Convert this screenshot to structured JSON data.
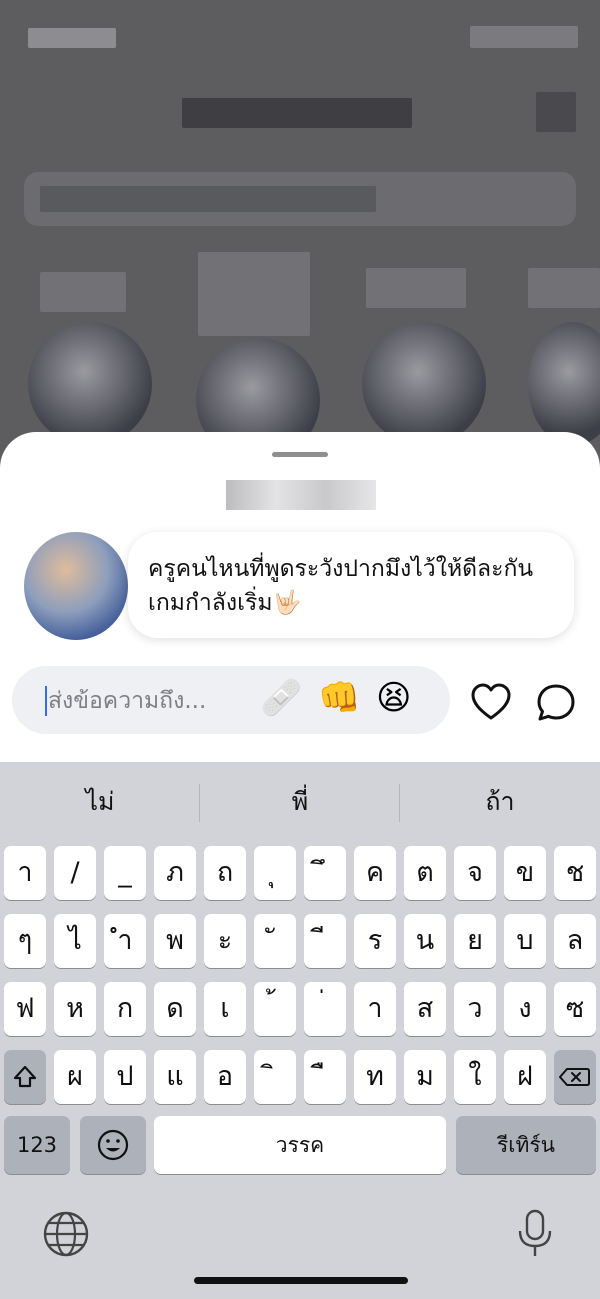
{
  "message": {
    "text": "ครูคนไหนที่พูดระวังปากมึงไว้ให้ดีละกัน เกมกำลังเริ่ม🤟🏻"
  },
  "composer": {
    "placeholder": "ส่งข้อความถึง...",
    "quick_reactions": [
      "🩹",
      "👊",
      "😫"
    ]
  },
  "keyboard": {
    "suggestions": [
      "ไม่",
      "พี่",
      "ถ้า"
    ],
    "rows": [
      [
        "า",
        "/",
        "_",
        "ภ",
        "ถ",
        "ุ",
        "ึ",
        "ค",
        "ต",
        "จ",
        "ข",
        "ช"
      ],
      [
        "ๆ",
        "ไ",
        "ำ",
        "พ",
        "ะ",
        "ั",
        "ี",
        "ร",
        "น",
        "ย",
        "บ",
        "ล"
      ],
      [
        "ฟ",
        "ห",
        "ก",
        "ด",
        "เ",
        "้",
        "่",
        "า",
        "ส",
        "ว",
        "ง",
        "ซ"
      ],
      [
        "ผ",
        "ป",
        "แ",
        "อ",
        "ิ",
        "ื",
        "ท",
        "ม",
        "ใ",
        "ฝ"
      ]
    ],
    "numbers_label": "123",
    "space_label": "วรรค",
    "return_label": "รีเทิร์น",
    "shift_icon": "shift-arrow-icon",
    "delete_icon": "backspace-icon",
    "emoji_icon": "emoji-icon",
    "globe_icon": "globe-icon",
    "mic_icon": "microphone-icon"
  },
  "colors": {
    "caret": "#2f6bff",
    "keyboard_bg": "#d1d3d9",
    "dim_overlay": "#5d5d60"
  }
}
